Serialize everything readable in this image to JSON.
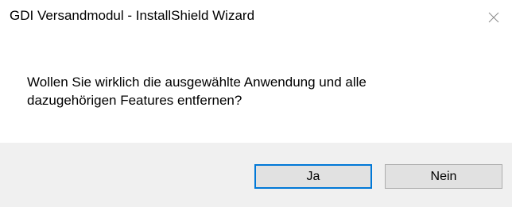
{
  "window": {
    "title": "GDI Versandmodul - InstallShield Wizard",
    "close_icon": "close-icon"
  },
  "message": {
    "line1": "Wollen Sie wirklich die ausgewählte Anwendung und alle",
    "line2": "dazugehörigen Features entfernen?"
  },
  "buttons": {
    "yes_label": "Ja",
    "no_label": "Nein"
  },
  "colors": {
    "focus_border": "#0078d7",
    "footer_bg": "#f0f0f0",
    "button_bg": "#e1e1e1"
  }
}
